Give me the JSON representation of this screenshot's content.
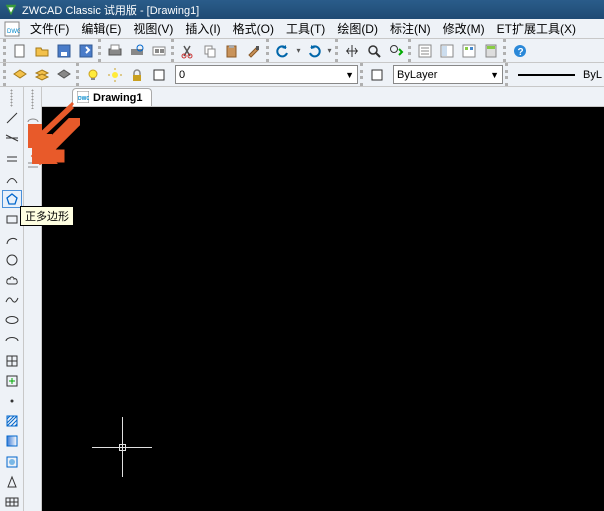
{
  "title": "ZWCAD Classic 试用版 - [Drawing1]",
  "menus": {
    "file": "文件(F)",
    "edit": "编辑(E)",
    "view": "视图(V)",
    "insert": "插入(I)",
    "format": "格式(O)",
    "tools": "工具(T)",
    "draw": "绘图(D)",
    "dim": "标注(N)",
    "modify": "修改(M)",
    "et": "ET扩展工具(X)"
  },
  "layer_combo": {
    "value": "0",
    "bylayer": "ByLayer",
    "bylabel": "ByL"
  },
  "doc_tab": "Drawing1",
  "tooltip": "正多边形"
}
